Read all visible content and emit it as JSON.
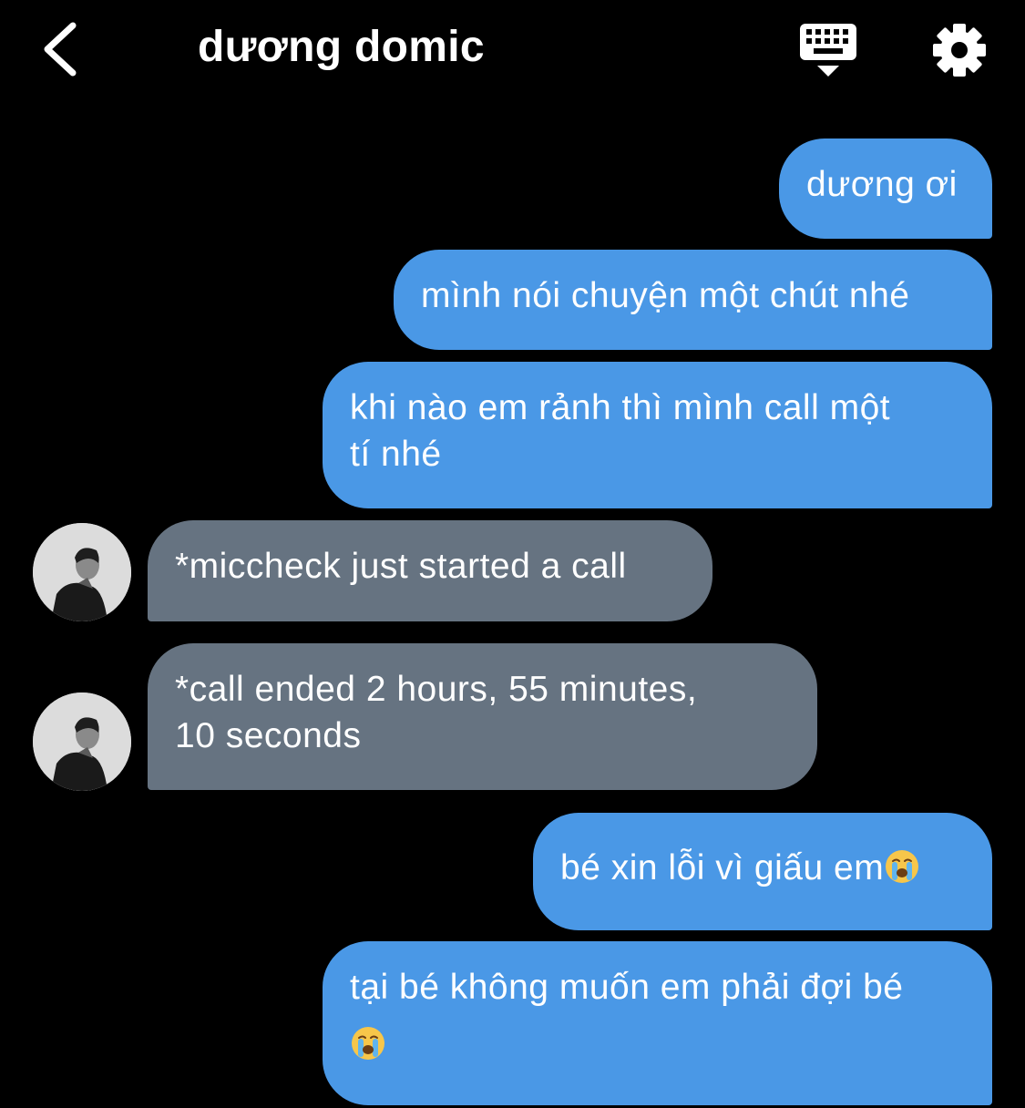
{
  "header": {
    "title": "dương domic",
    "back_icon": "chevron-left-icon",
    "keyboard_icon": "keyboard-hide-icon",
    "settings_icon": "gear-icon"
  },
  "colors": {
    "background": "#000000",
    "sent_bubble": "#4a98e6",
    "received_bubble": "#667381",
    "text": "#ffffff"
  },
  "messages": [
    {
      "direction": "sent",
      "text": "dương ơi"
    },
    {
      "direction": "sent",
      "text": "mình nói chuyện một chút nhé"
    },
    {
      "direction": "sent",
      "line1": "khi nào em rảnh thì mình call một",
      "line2": "tí nhé"
    },
    {
      "direction": "received",
      "text": "*miccheck just started a call"
    },
    {
      "direction": "received",
      "line1": "*call ended 2 hours, 55 minutes,",
      "line2": "10 seconds"
    },
    {
      "direction": "sent",
      "text": "bé xin lỗi vì giấu em",
      "emoji": "loudly-crying-face"
    },
    {
      "direction": "sent",
      "text": "tại bé không muốn em phải đợi bé",
      "emoji": "loudly-crying-face"
    }
  ]
}
